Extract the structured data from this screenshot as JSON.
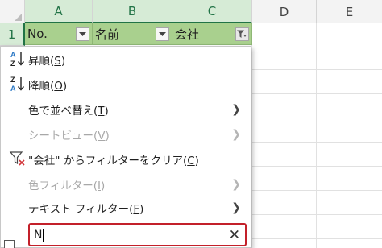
{
  "sheet": {
    "columns": [
      "A",
      "B",
      "C",
      "D",
      "E"
    ],
    "rows": [
      "1"
    ],
    "header_cells": [
      "No.",
      "名前",
      "会社"
    ]
  },
  "filter_menu": {
    "sort_asc": {
      "label": "昇順(",
      "key": "S",
      "suffix": ")"
    },
    "sort_desc": {
      "label": "降順(",
      "key": "O",
      "suffix": ")"
    },
    "sort_by_color": {
      "label": "色で並べ替え(",
      "key": "T",
      "suffix": ")"
    },
    "sheet_view": {
      "label": "シートビュー(",
      "key": "V",
      "suffix": ")"
    },
    "clear_filter": {
      "label": "\"会社\" からフィルターをクリア(",
      "key": "C",
      "suffix": ")"
    },
    "color_filter": {
      "label": "色フィルター(",
      "key": "I",
      "suffix": ")"
    },
    "text_filter": {
      "label": "テキスト フィルター(",
      "key": "F",
      "suffix": ")"
    },
    "search": {
      "value": "N"
    }
  },
  "colors": {
    "header_fill": "#a9d08e",
    "selected_header": "#d6ebd6",
    "accent_green": "#217346",
    "search_border": "#c3202a"
  }
}
